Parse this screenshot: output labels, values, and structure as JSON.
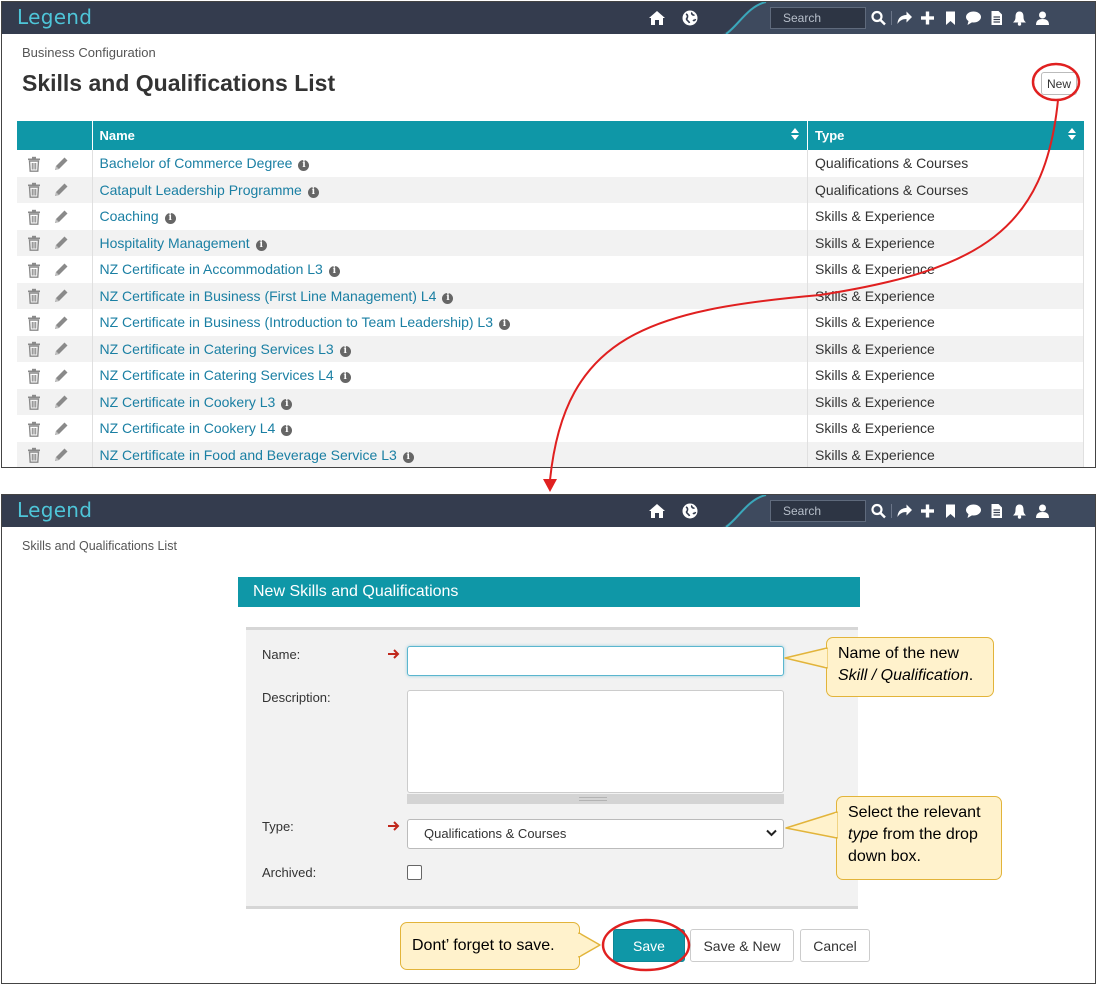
{
  "app": {
    "logo": "Legend",
    "search_placeholder": "Search"
  },
  "list_page": {
    "breadcrumb": "Business Configuration",
    "title": "Skills and Qualifications List",
    "new_button": "New",
    "columns": [
      "Name",
      "Type"
    ],
    "rows": [
      {
        "name": "Bachelor of Commerce Degree",
        "type": "Qualifications & Courses"
      },
      {
        "name": "Catapult Leadership Programme",
        "type": "Qualifications & Courses"
      },
      {
        "name": "Coaching",
        "type": "Skills & Experience"
      },
      {
        "name": "Hospitality Management",
        "type": "Skills & Experience"
      },
      {
        "name": "NZ Certificate in Accommodation L3",
        "type": "Skills & Experience"
      },
      {
        "name": "NZ Certificate in Business (First Line Management) L4",
        "type": "Skills & Experience"
      },
      {
        "name": "NZ Certificate in Business (Introduction to Team Leadership) L3",
        "type": "Skills & Experience"
      },
      {
        "name": "NZ Certificate in Catering Services L3",
        "type": "Skills & Experience"
      },
      {
        "name": "NZ Certificate in Catering Services L4",
        "type": "Skills & Experience"
      },
      {
        "name": "NZ Certificate in Cookery L3",
        "type": "Skills & Experience"
      },
      {
        "name": "NZ Certificate in Cookery L4",
        "type": "Skills & Experience"
      },
      {
        "name": "NZ Certificate in Food and Beverage Service L3",
        "type": "Skills & Experience"
      }
    ]
  },
  "form_page": {
    "breadcrumb": "Skills and Qualifications List",
    "header": "New Skills and Qualifications",
    "labels": {
      "name": "Name:",
      "description": "Description:",
      "type": "Type:",
      "archived": "Archived:"
    },
    "values": {
      "name": "",
      "description": "",
      "type": "Qualifications & Courses",
      "archived": false
    },
    "buttons": {
      "save": "Save",
      "save_new": "Save & New",
      "cancel": "Cancel"
    }
  },
  "callouts": {
    "name_line1": "Name of the new",
    "name_line2_italic": "Skill / Qualification",
    "name_line2_end": ".",
    "type_line1": "Select the relevant",
    "type_line2_italic": "type",
    "type_line2_rest": " from the drop",
    "type_line3": "down box.",
    "save": "Dont’ forget to save."
  },
  "colors": {
    "navbar": "#343c4e",
    "logo": "#4ec5d8",
    "accent_teal": "#0f97a7",
    "link": "#1a7fa3",
    "annotation_red": "#e02020",
    "callout_fill": "#fff2cc",
    "callout_border": "#e2b43a"
  },
  "icons": [
    "home-icon",
    "globe-icon",
    "search-icon",
    "share-icon",
    "plus-icon",
    "bookmark-icon",
    "chat-icon",
    "document-icon",
    "bell-icon",
    "user-icon",
    "trash-icon",
    "pencil-icon",
    "info-icon",
    "sort-icon",
    "chevron-down-icon",
    "required-arrow-icon"
  ]
}
